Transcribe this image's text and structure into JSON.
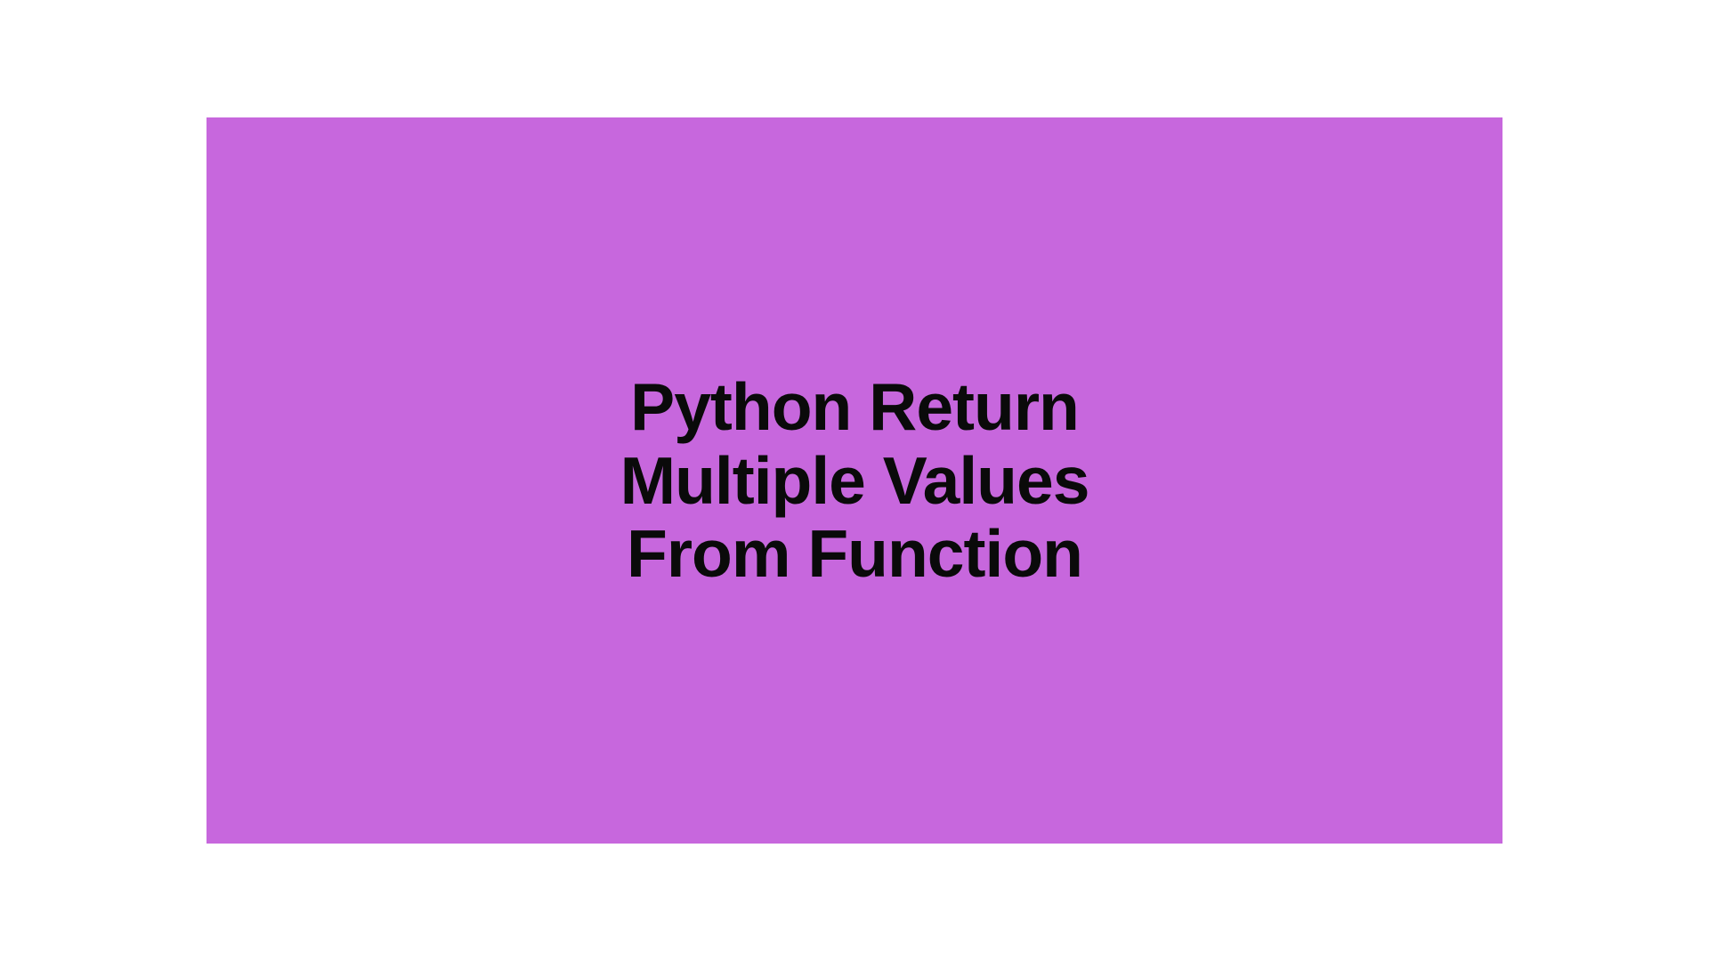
{
  "banner": {
    "title_line1": "Python Return",
    "title_line2": "Multiple Values",
    "title_line3": "From Function",
    "background_color": "#c767dd",
    "text_color": "#0a0a0a"
  }
}
